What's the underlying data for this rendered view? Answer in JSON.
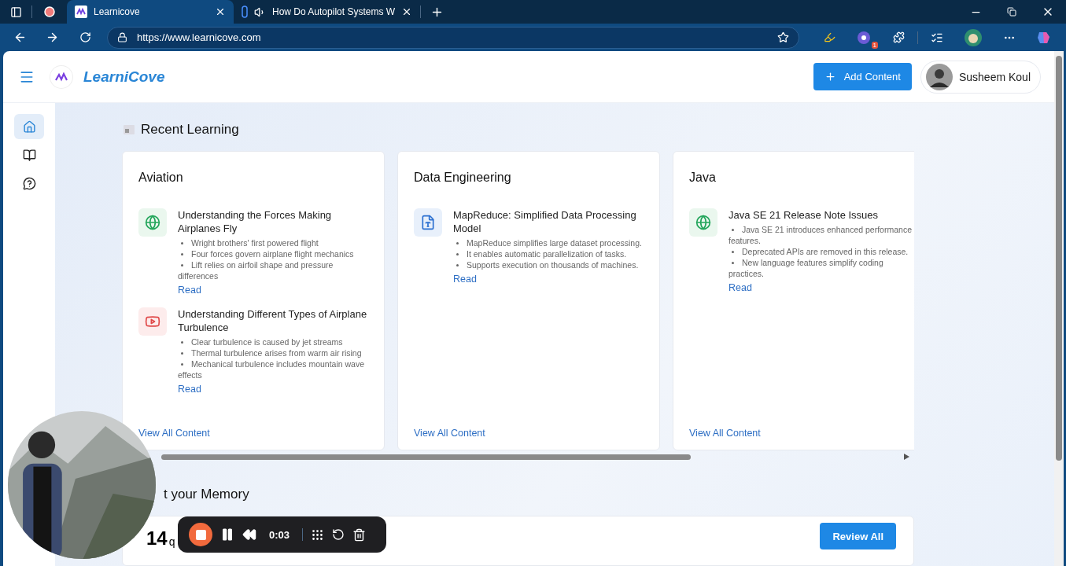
{
  "browser": {
    "tabs": [
      {
        "title": "Learnicove",
        "selected": true,
        "kind": "site"
      },
      {
        "title": "How Do Autopilot Systems W",
        "selected": false,
        "kind": "audio"
      }
    ],
    "url": "https://www.learnicove.com",
    "extension_badge": "1"
  },
  "header": {
    "brand": "LearniCove",
    "add_button": "Add Content",
    "user_name": "Susheem Koul"
  },
  "sidebar": {
    "items": [
      {
        "kind": "home",
        "selected": true
      },
      {
        "kind": "book",
        "selected": false
      },
      {
        "kind": "help",
        "selected": false
      }
    ]
  },
  "recent_learning": {
    "title": "Recent Learning",
    "cards": [
      {
        "title": "Aviation",
        "items": [
          {
            "kind": "web",
            "title": "Understanding the Forces Making Airplanes Fly",
            "bullets": [
              "Wright brothers' first powered flight",
              "Four forces govern airplane flight mechanics",
              "Lift relies on airfoil shape and pressure differences"
            ],
            "link": "Read"
          },
          {
            "kind": "video",
            "title": "Understanding Different Types of Airplane Turbulence",
            "bullets": [
              "Clear turbulence is caused by jet streams",
              "Thermal turbulence arises from warm air rising",
              "Mechanical turbulence includes mountain wave effects"
            ],
            "link": "Read"
          }
        ],
        "view_all": "View All Content"
      },
      {
        "title": "Data Engineering",
        "items": [
          {
            "kind": "doc",
            "title": "MapReduce: Simplified Data Processing Model",
            "bullets": [
              "MapReduce simplifies large dataset processing.",
              "It enables automatic parallelization of tasks.",
              "Supports execution on thousands of machines."
            ],
            "link": "Read"
          }
        ],
        "view_all": "View All Content"
      },
      {
        "title": "Java",
        "items": [
          {
            "kind": "web",
            "title": "Java SE 21 Release Note Issues",
            "bullets": [
              "Java SE 21 introduces enhanced performance features.",
              "Deprecated APIs are removed in this release.",
              "New language features simplify coding practices."
            ],
            "link": "Read"
          }
        ],
        "view_all": "View All Content"
      }
    ]
  },
  "memory": {
    "title": "t your Memory",
    "count": "14",
    "count_unit": "q",
    "button": "Review All"
  },
  "recorder": {
    "time": "0:03"
  }
}
